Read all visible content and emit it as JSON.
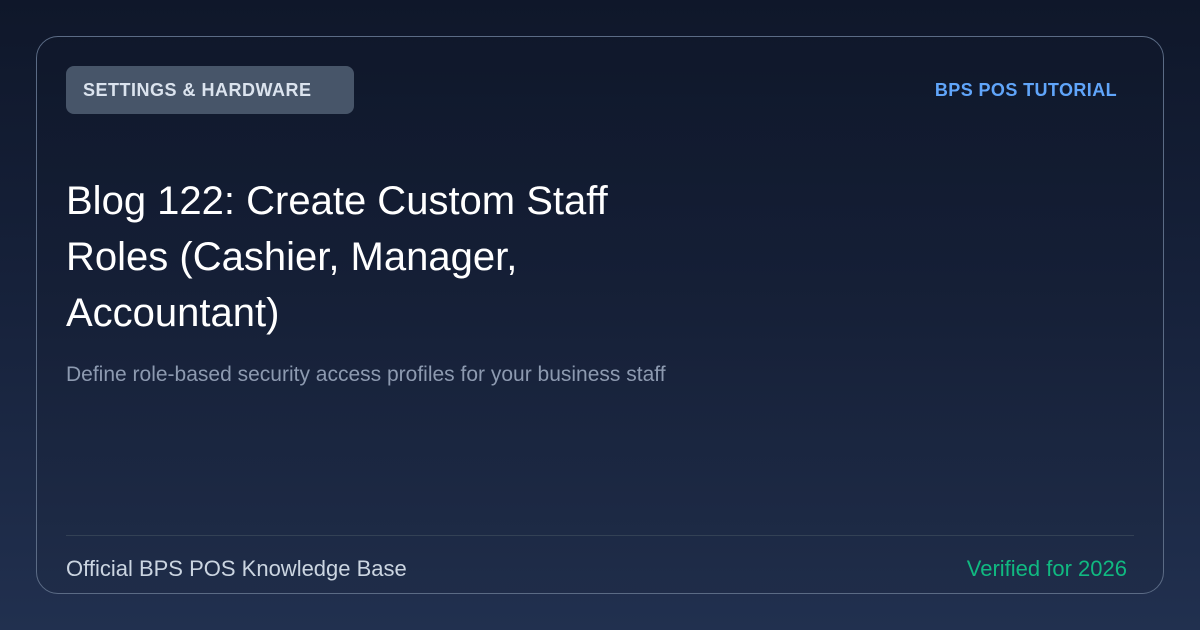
{
  "header": {
    "category": "SETTINGS & HARDWARE",
    "brand": "BPS POS TUTORIAL"
  },
  "main": {
    "title": "Blog 122: Create Custom Staff Roles (Cashier, Manager, Accountant)",
    "subtitle": "Define role-based security access profiles for your business staff"
  },
  "footer": {
    "source": "Official BPS POS Knowledge Base",
    "verified": "Verified for 2026"
  },
  "colors": {
    "background": "#0f172a",
    "badge": "#475569",
    "brand_accent": "#60a5fa",
    "verified_accent": "#10b981"
  }
}
